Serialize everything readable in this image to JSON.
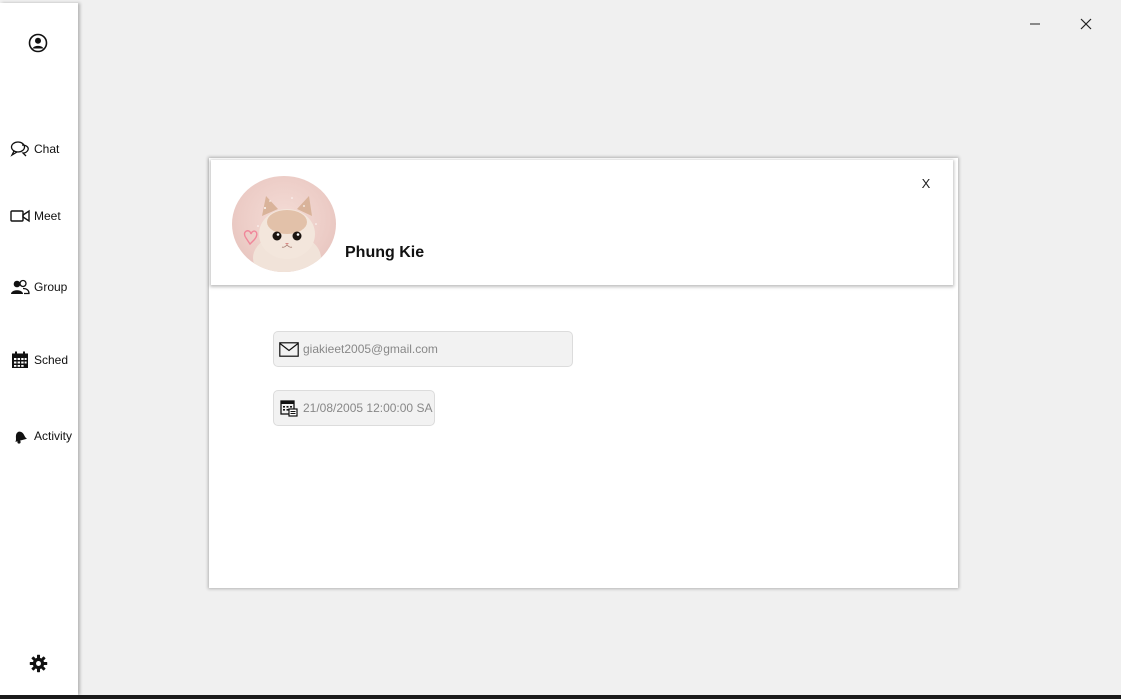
{
  "sidebar": {
    "items": [
      {
        "label": "Chat",
        "icon": "chat-icon"
      },
      {
        "label": "Meet",
        "icon": "video-camera-icon"
      },
      {
        "label": "Group",
        "icon": "group-icon"
      },
      {
        "label": "Sched",
        "icon": "calendar-icon"
      },
      {
        "label": "Activity",
        "icon": "bell-icon"
      }
    ],
    "profile_icon": "user-circle-icon",
    "settings_icon": "gear-icon"
  },
  "window": {
    "minimize_icon": "minimize-icon",
    "close_icon": "close-icon"
  },
  "profile": {
    "close_label": "X",
    "name": "Phung Kie",
    "avatar": "cat-avatar",
    "email": "giakieet2005@gmail.com",
    "dob": "21/08/2005 12:00:00 SA"
  },
  "colors": {
    "background": "#f0f0f0",
    "panel": "#ffffff",
    "field_bg": "#f2f2f2",
    "field_text": "#888888"
  }
}
